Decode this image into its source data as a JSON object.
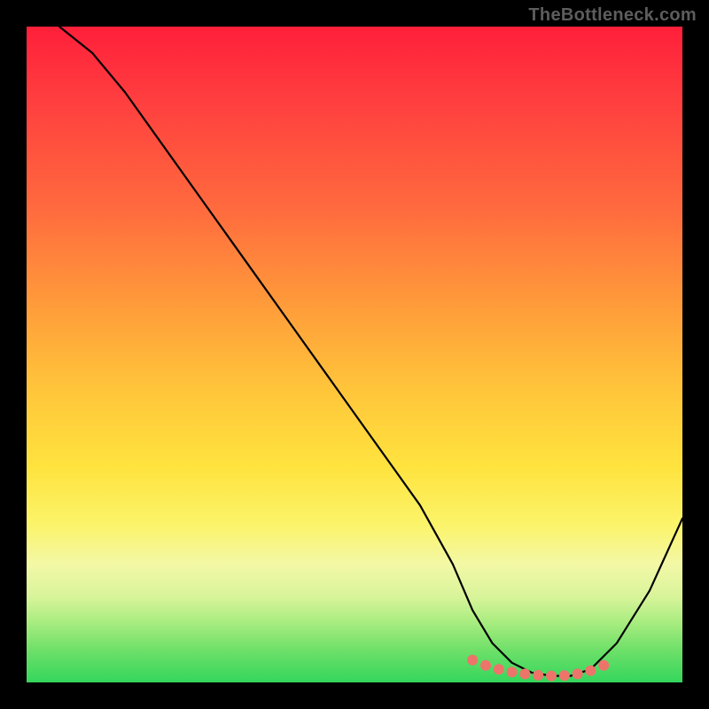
{
  "watermark": "TheBottleneck.com",
  "chart_data": {
    "type": "line",
    "title": "",
    "xlabel": "",
    "ylabel": "",
    "xlim": [
      0,
      100
    ],
    "ylim": [
      0,
      100
    ],
    "grid": false,
    "series": [
      {
        "name": "bottleneck-curve",
        "x": [
          5,
          10,
          15,
          20,
          25,
          30,
          35,
          40,
          45,
          50,
          55,
          60,
          65,
          68,
          71,
          74,
          77,
          80,
          83,
          86,
          90,
          95,
          100
        ],
        "y": [
          100,
          96,
          90,
          83,
          76,
          69,
          62,
          55,
          48,
          41,
          34,
          27,
          18,
          11,
          6,
          3,
          1.5,
          1,
          1,
          2,
          6,
          14,
          25
        ]
      }
    ],
    "optimal_markers": {
      "name": "optimal-range-dots",
      "color": "#ed746b",
      "x": [
        68,
        70,
        72,
        74,
        76,
        78,
        80,
        82,
        84,
        86,
        88
      ],
      "y": [
        3.4,
        2.6,
        2.0,
        1.6,
        1.3,
        1.1,
        1.0,
        1.05,
        1.3,
        1.8,
        2.6
      ]
    },
    "gradient_stops": [
      {
        "pos": 0,
        "color": "#ff1f3a"
      },
      {
        "pos": 10,
        "color": "#ff3b3f"
      },
      {
        "pos": 28,
        "color": "#ff6b3e"
      },
      {
        "pos": 42,
        "color": "#ff9a3a"
      },
      {
        "pos": 55,
        "color": "#ffc43a"
      },
      {
        "pos": 67,
        "color": "#ffe33e"
      },
      {
        "pos": 76,
        "color": "#fbf46a"
      },
      {
        "pos": 82,
        "color": "#f3f8a6"
      },
      {
        "pos": 87,
        "color": "#d8f49a"
      },
      {
        "pos": 91,
        "color": "#a6ec7e"
      },
      {
        "pos": 95,
        "color": "#6fe069"
      },
      {
        "pos": 100,
        "color": "#34d65c"
      }
    ]
  }
}
